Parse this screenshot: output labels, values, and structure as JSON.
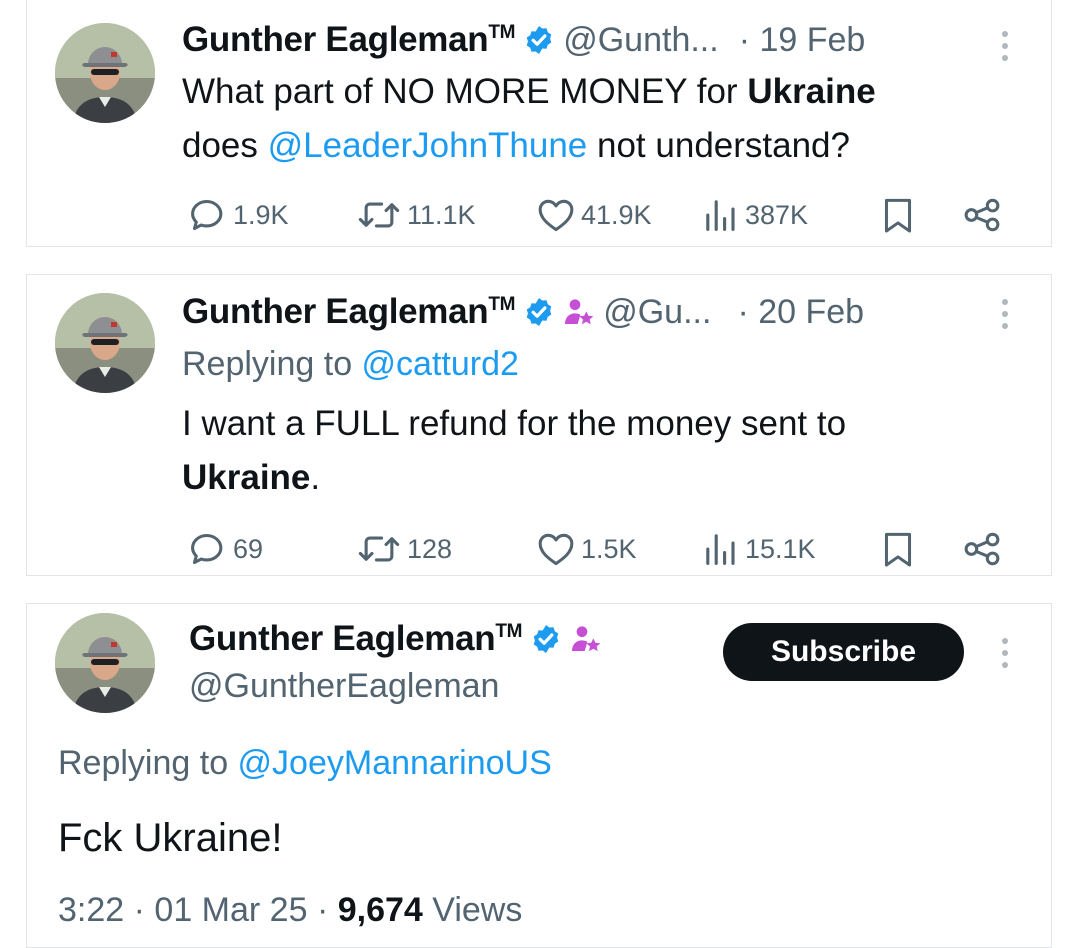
{
  "tweets": [
    {
      "author": "Gunther Eagleman",
      "tm": "TM",
      "handle": "@Gunth...",
      "date": "· 19 Feb",
      "text_a": "What part of NO MORE MONEY for ",
      "text_bold": "Ukraine",
      "text_b": "does ",
      "mention": "@LeaderJohnThune",
      "text_c": " not understand?",
      "stats": {
        "replies": "1.9K",
        "reposts": "11.1K",
        "likes": "41.9K",
        "views": "387K"
      }
    },
    {
      "author": "Gunther Eagleman",
      "tm": "TM",
      "handle": "@Gu...",
      "date": "· 20 Feb",
      "replying_prefix": "Replying to ",
      "replying_to": "@catturd2",
      "text_a": "I want a FULL refund for the money sent to",
      "text_bold": "Ukraine",
      "text_end": ".",
      "stats": {
        "replies": "69",
        "reposts": "128",
        "likes": "1.5K",
        "views": "15.1K"
      }
    },
    {
      "author": "Gunther Eagleman",
      "tm": "TM",
      "handle": "@GuntherEagleman",
      "subscribe_label": "Subscribe",
      "replying_prefix": "Replying to ",
      "replying_to": "@JoeyMannarinoUS",
      "text": "Fck Ukraine!",
      "time": "3:22",
      "sep1": " · ",
      "date": "01 Mar 25",
      "sep2": " · ",
      "views_count": "9,674",
      "views_label": " Views"
    }
  ],
  "colors": {
    "verified": "#1d9bf0",
    "link": "#1d9bf0",
    "muted": "#536471",
    "subscriber_badge": "#c64fd6"
  },
  "icons": [
    "verified-badge-icon",
    "subscriber-badge-icon",
    "reply-icon",
    "repost-icon",
    "like-icon",
    "views-icon",
    "bookmark-icon",
    "share-icon",
    "more-icon"
  ]
}
